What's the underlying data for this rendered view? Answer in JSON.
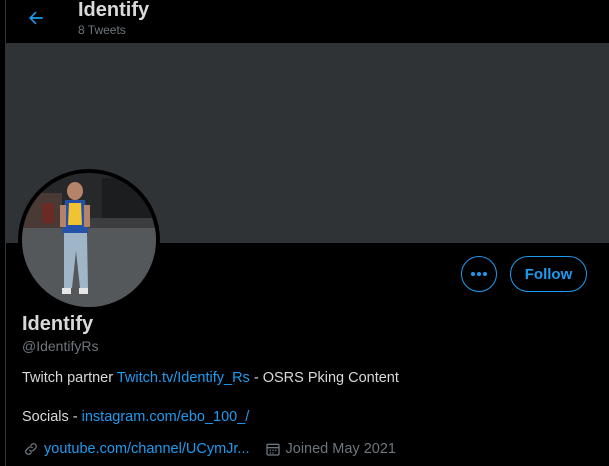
{
  "header": {
    "title": "Identify",
    "tweet_count": "8 Tweets"
  },
  "profile": {
    "name": "Identify",
    "handle": "@IdentifyRs",
    "follow_label": "Follow",
    "bio": {
      "prefix": "Twitch partner ",
      "link": "Twitch.tv/Identify_Rs",
      "suffix": " - OSRS Pking Content"
    },
    "socials": {
      "label": "Socials - ",
      "link": "instagram.com/ebo_100_/"
    },
    "website": "youtube.com/channel/UCymJr...",
    "joined": "Joined May 2021"
  },
  "colors": {
    "accent": "#1d9bf0",
    "banner": "#2f3336",
    "muted": "#6e767d",
    "text": "#d9d9d9"
  },
  "icons": {
    "back": "arrow-left-icon",
    "more": "more-dots-icon",
    "link": "link-icon",
    "calendar": "calendar-icon"
  }
}
